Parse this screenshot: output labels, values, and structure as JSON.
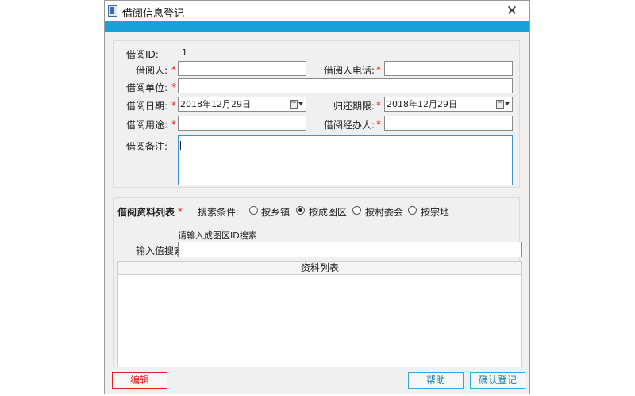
{
  "window": {
    "title": "借阅信息登记",
    "close_glyph": "✕",
    "accent_color": "#17a2d8"
  },
  "form": {
    "borrow_id_label": "借阅ID:",
    "borrow_id_value": "1",
    "borrower_label": "借阅人:",
    "borrower_phone_label": "借阅人电话:",
    "borrower_unit_label": "借阅单位:",
    "borrow_date_label": "借阅日期:",
    "borrow_date_value": "2018年12月29日",
    "return_date_label": "归还期限:",
    "return_date_value": "2018年12月29日",
    "purpose_label": "借阅用途:",
    "handler_label": "借阅经办人:",
    "remark_label": "借阅备注:",
    "required_mark": "*"
  },
  "materials": {
    "title": "借阅资料列表",
    "search_condition_label": "搜索条件:",
    "options": [
      "按乡镇",
      "按成图区",
      "按村委会",
      "按宗地"
    ],
    "selected_index": 1,
    "hint": "请输入成图区ID搜索",
    "search_label": "输入值搜索:",
    "list_header": "资料列表"
  },
  "buttons": {
    "edit": "编辑",
    "help": "帮助",
    "confirm": "确认登记"
  },
  "colors": {
    "required": "#e02020",
    "edit_border": "#e02020",
    "action_border": "#2fa8d5"
  }
}
